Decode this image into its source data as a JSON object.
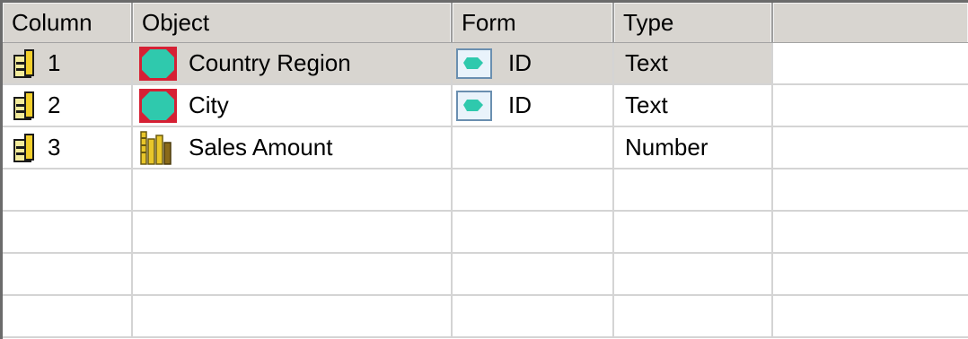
{
  "columns": {
    "column": "Column",
    "object": "Object",
    "form": "Form",
    "type": "Type"
  },
  "rows": [
    {
      "column": "1",
      "object": "Country Region",
      "object_icon": "attribute-icon",
      "form": "ID",
      "form_icon": "form-id-icon",
      "type": "Text",
      "selected": true
    },
    {
      "column": "2",
      "object": "City",
      "object_icon": "attribute-icon",
      "form": "ID",
      "form_icon": "form-id-icon",
      "type": "Text",
      "selected": false
    },
    {
      "column": "3",
      "object": "Sales Amount",
      "object_icon": "metric-icon",
      "form": "",
      "form_icon": "",
      "type": "Number",
      "selected": false
    }
  ],
  "colors": {
    "header_bg": "#d8d5d0",
    "selected_bg": "#d8d5d0",
    "attribute_teal": "#2fc9ad",
    "attribute_red": "#d62034",
    "metric_yellow": "#e8c62a"
  }
}
